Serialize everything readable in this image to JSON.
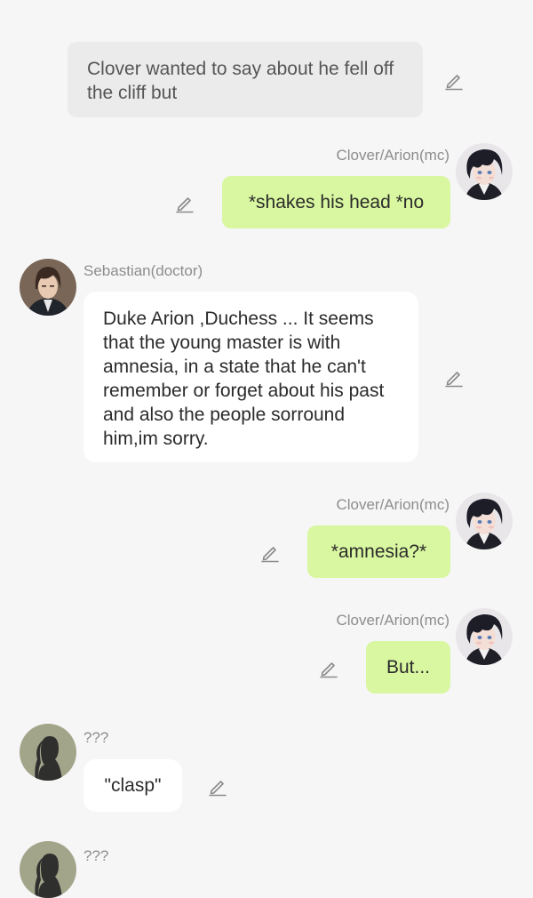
{
  "messages": [
    {
      "type": "narration",
      "text": "Clover wanted to say about he fell off the cliff but"
    },
    {
      "type": "user",
      "name": "Clover/Arion(mc)",
      "text": "*shakes his head *no"
    },
    {
      "type": "npc",
      "name": "Sebastian(doctor)",
      "text": "Duke Arion ,Duchess ... It seems that  the young master  is with amnesia, in a state that he can't remember or forget about his past and also the people sorround him,im sorry."
    },
    {
      "type": "user",
      "name": "Clover/Arion(mc)",
      "text": "*amnesia?*"
    },
    {
      "type": "user",
      "name": "Clover/Arion(mc)",
      "text": "But..."
    },
    {
      "type": "npc",
      "name": "???",
      "text": "\"clasp\""
    },
    {
      "type": "npc",
      "name": "???",
      "text": ""
    }
  ],
  "icons": {
    "edit": "pencil-edit-icon"
  },
  "colors": {
    "user_bubble": "#d9f7a0",
    "npc_bubble": "#ffffff",
    "narration_bubble": "#ebebeb",
    "background": "#f6f6f6"
  }
}
